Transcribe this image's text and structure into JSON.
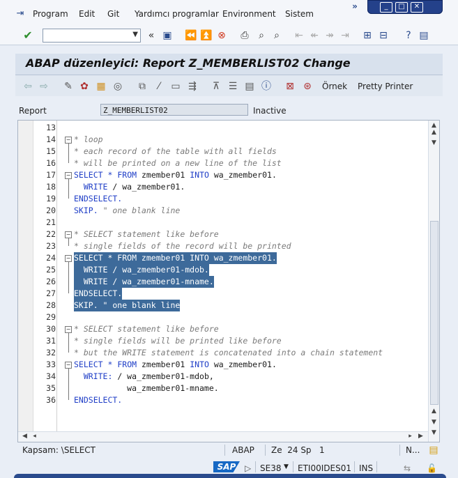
{
  "menu": [
    "Program",
    "Edit",
    "Git",
    "Yardımcı programlar",
    "Environment",
    "Sistem"
  ],
  "title": "ABAP düzenleyici: Report Z_MEMBERLIST02 Change",
  "toolbar2": {
    "ornek": "Örnek",
    "pretty_printer": "Pretty Printer"
  },
  "report": {
    "label": "Report",
    "value": "Z_MEMBERLIST02",
    "status": "Inactive"
  },
  "editor": {
    "lines": [
      {
        "n": "13",
        "segs": [
          {
            "t": "",
            "c": ""
          }
        ]
      },
      {
        "n": "14",
        "segs": [
          {
            "t": "* loop",
            "c": "cm"
          }
        ]
      },
      {
        "n": "15",
        "segs": [
          {
            "t": "* each record of the table with all fields",
            "c": "cm"
          }
        ]
      },
      {
        "n": "16",
        "segs": [
          {
            "t": "* will be printed on a new line of the list",
            "c": "cm"
          }
        ]
      },
      {
        "n": "17",
        "segs": [
          {
            "t": "SELECT",
            "c": "kw"
          },
          {
            "t": " ",
            "c": ""
          },
          {
            "t": "*",
            "c": "kw"
          },
          {
            "t": " ",
            "c": ""
          },
          {
            "t": "FROM",
            "c": "kw"
          },
          {
            "t": " zmember01 ",
            "c": ""
          },
          {
            "t": "INTO",
            "c": "kw"
          },
          {
            "t": " wa_zmember01.",
            "c": ""
          }
        ]
      },
      {
        "n": "18",
        "segs": [
          {
            "t": "  ",
            "c": ""
          },
          {
            "t": "WRITE",
            "c": "kw"
          },
          {
            "t": " / wa_zmember01.",
            "c": ""
          }
        ]
      },
      {
        "n": "19",
        "segs": [
          {
            "t": "ENDSELECT.",
            "c": "kw"
          }
        ]
      },
      {
        "n": "20",
        "segs": [
          {
            "t": "SKIP.",
            "c": "kw"
          },
          {
            "t": " ",
            "c": ""
          },
          {
            "t": "\" one blank line",
            "c": "cm"
          }
        ]
      },
      {
        "n": "21",
        "segs": [
          {
            "t": "",
            "c": ""
          }
        ]
      },
      {
        "n": "22",
        "segs": [
          {
            "t": "* SELECT statement like before",
            "c": "cm"
          }
        ]
      },
      {
        "n": "23",
        "segs": [
          {
            "t": "* single fields of the record will be printed",
            "c": "cm"
          }
        ]
      },
      {
        "n": "24",
        "sel": true,
        "segs": [
          {
            "t": "SELECT * FROM zmember01 INTO wa_zmember01.",
            "c": ""
          }
        ]
      },
      {
        "n": "25",
        "sel": true,
        "segs": [
          {
            "t": "  WRITE / wa_zmember01-mdob.",
            "c": ""
          }
        ]
      },
      {
        "n": "26",
        "sel": true,
        "segs": [
          {
            "t": "  WRITE / wa_zmember01-mname.",
            "c": ""
          }
        ]
      },
      {
        "n": "27",
        "sel": true,
        "segs": [
          {
            "t": "ENDSELECT.",
            "c": ""
          }
        ]
      },
      {
        "n": "28",
        "sel": true,
        "segs": [
          {
            "t": "SKIP. \" one blank line",
            "c": ""
          }
        ]
      },
      {
        "n": "29",
        "segs": [
          {
            "t": "",
            "c": ""
          }
        ]
      },
      {
        "n": "30",
        "segs": [
          {
            "t": "* SELECT statement like before",
            "c": "cm"
          }
        ]
      },
      {
        "n": "31",
        "segs": [
          {
            "t": "* single fields will be printed like before",
            "c": "cm"
          }
        ]
      },
      {
        "n": "32",
        "segs": [
          {
            "t": "* but the WRITE statement is concatenated into a chain statement",
            "c": "cm"
          }
        ]
      },
      {
        "n": "33",
        "segs": [
          {
            "t": "SELECT",
            "c": "kw"
          },
          {
            "t": " ",
            "c": ""
          },
          {
            "t": "*",
            "c": "kw"
          },
          {
            "t": " ",
            "c": ""
          },
          {
            "t": "FROM",
            "c": "kw"
          },
          {
            "t": " zmember01 ",
            "c": ""
          },
          {
            "t": "INTO",
            "c": "kw"
          },
          {
            "t": " wa_zmember01.",
            "c": ""
          }
        ]
      },
      {
        "n": "34",
        "segs": [
          {
            "t": "  ",
            "c": ""
          },
          {
            "t": "WRITE:",
            "c": "kw"
          },
          {
            "t": " / wa_zmember01-mdob,",
            "c": ""
          }
        ]
      },
      {
        "n": "35",
        "segs": [
          {
            "t": "           wa_zmember01-mname.",
            "c": ""
          }
        ]
      },
      {
        "n": "36",
        "segs": [
          {
            "t": "ENDSELECT.",
            "c": "kw"
          }
        ]
      }
    ]
  },
  "status": {
    "scope": "Kapsam: \\SELECT",
    "lang": "ABAP",
    "pos": "Ze  24 Sp   1",
    "mode": "N..."
  },
  "bottom": {
    "logo": "SAP",
    "tcode": "SE38",
    "system": "ETI00IDES01",
    "ins": "INS"
  },
  "colors": {
    "selection": "#3d6a9a",
    "keyword": "#1f3ec7",
    "comment": "#7a7a7a",
    "title_bg": "#d8e1ed"
  }
}
